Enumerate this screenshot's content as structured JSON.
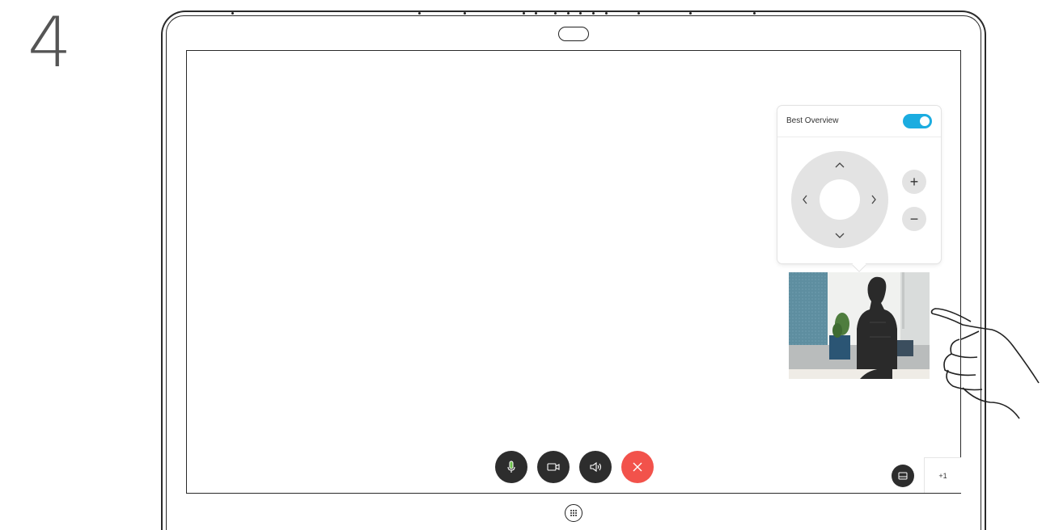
{
  "step": {
    "number": "4"
  },
  "camera_control": {
    "title": "Best Overview",
    "best_overview_enabled": true,
    "pan_up_icon": "chevron-up-icon",
    "pan_down_icon": "chevron-down-icon",
    "pan_left_icon": "chevron-left-icon",
    "pan_right_icon": "chevron-right-icon",
    "zoom_in_label": "+",
    "zoom_out_label": "−"
  },
  "call_controls": {
    "mute_icon": "microphone-icon",
    "video_icon": "video-camera-icon",
    "volume_icon": "speaker-icon",
    "end_call_icon": "close-icon"
  },
  "layout_icon": "layout-icon",
  "participants": {
    "label": "+1"
  },
  "home_icon": "keypad-icon",
  "colors": {
    "accent": "#1bace0",
    "end_call": "#f2524b",
    "control_bg": "#2d2d2d",
    "mic_active": "#6cc04a"
  }
}
